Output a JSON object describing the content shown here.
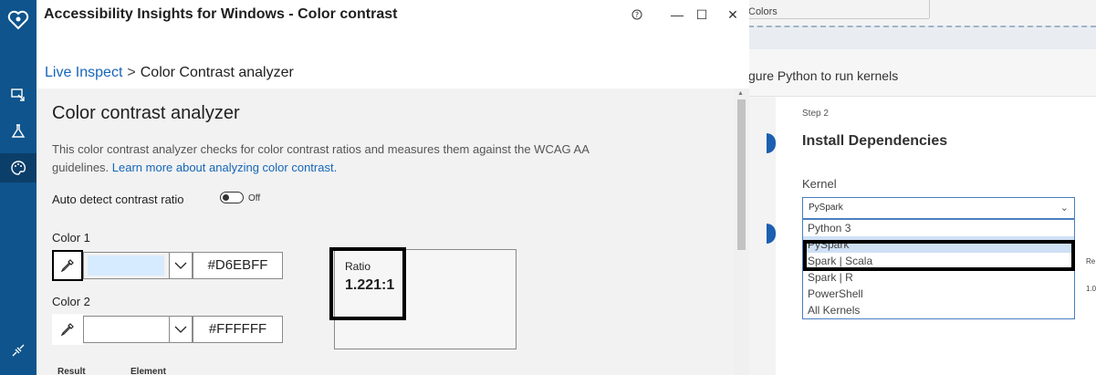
{
  "window": {
    "title": "Accessibility Insights for Windows - Color contrast",
    "help": "?",
    "minimize": "—",
    "maximize": "☐",
    "close": "✕"
  },
  "breadcrumb": {
    "live": "Live Inspect",
    "separator": ">",
    "current": "Color Contrast analyzer"
  },
  "panel": {
    "title": "Color contrast analyzer",
    "description": "This color contrast analyzer checks for color contrast ratios and measures them against the WCAG AA guidelines. ",
    "learn_more": "Learn more about analyzing color contrast.",
    "auto_detect_label": "Auto detect contrast ratio",
    "toggle_state": "Off",
    "color1_label": "Color 1",
    "color1_hex": "#D6EBFF",
    "color2_label": "Color 2",
    "color2_hex": "#FFFFFF",
    "ratio_label": "Ratio",
    "ratio_value": "1.221:1",
    "table_headers": [
      "Result",
      "Element"
    ]
  },
  "background_app": {
    "colors_tab": "Colors",
    "heading": "gure Python to run kernels",
    "step_label": "Step 2",
    "step_title": "Install Dependencies",
    "kernel_label": "Kernel",
    "kernel_selected": "PySpark",
    "kernel_options": [
      "Python 3",
      "PySpark",
      "Spark | Scala",
      "Spark | R",
      "PowerShell",
      "All Kernels"
    ],
    "side_label": "Re",
    "side_value": "1.0"
  },
  "colors": {
    "nav_rail": "#0f548c",
    "link": "#1566b8",
    "swatch_1": "#d6ebff",
    "swatch_2": "#ffffff"
  }
}
